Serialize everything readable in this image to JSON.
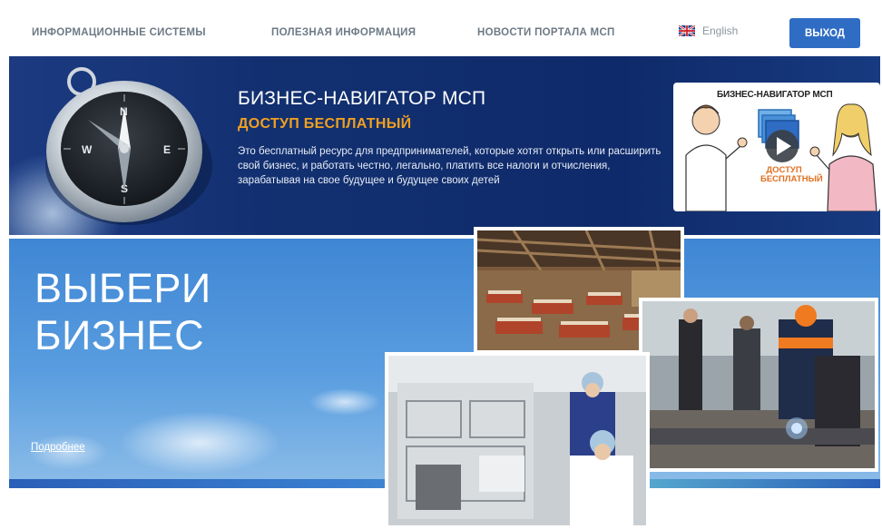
{
  "nav": {
    "items": [
      {
        "label": "ИНФОРМАЦИОННЫЕ СИСТЕМЫ"
      },
      {
        "label": "ПОЛЕЗНАЯ ИНФОРМАЦИЯ"
      },
      {
        "label": "НОВОСТИ ПОРТАЛА МСП"
      }
    ],
    "language_label": "English",
    "logout_label": "ВЫХОД"
  },
  "navigator_banner": {
    "title": "БИЗНЕС-НАВИГАТОР МСП",
    "subtitle": "ДОСТУП БЕСПЛАТНЫЙ",
    "description": "Это бесплатный ресурс для предпринимателей, которые хотят открыть или расширить свой бизнес, и работать честно, легально, платить все налоги и отчисления, зарабатывая на свое будущее и будущее своих детей",
    "video": {
      "title": "БИЗНЕС-НАВИГАТОР МСП",
      "caption": "ДОСТУП БЕСПЛАТНЫЙ"
    }
  },
  "business_banner": {
    "title_line1": "ВЫБЕРИ",
    "title_line2": "БИЗНЕС",
    "more_link": "Подробнее"
  },
  "colors": {
    "accent": "#2f6cc4",
    "navigator_bg": "#123070",
    "subtitle": "#f0a020",
    "business_bg": "#4a92da"
  },
  "icons": [
    "uk-flag-icon",
    "compass-icon",
    "play-icon"
  ]
}
